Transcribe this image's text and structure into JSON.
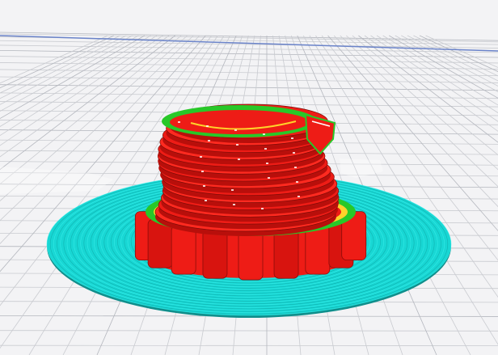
{
  "viewport": {
    "label": "",
    "view_mode": "layer-preview",
    "build_plate": "grid"
  },
  "colors": {
    "background": "#f3f3f5",
    "grid_line": "#c9cbd0",
    "grid_line_major": "#b4b7be",
    "axis_line": "#6a83c9",
    "skirt_brim": "#18d7d4",
    "skirt_brim_dark": "#0f8f8c",
    "wall_outer": "#ee1c16",
    "wall_inner": "#28c828",
    "infill": "#ffd22a",
    "support": "#9fe7ee"
  },
  "model": {
    "type": "spiral-gear-vase",
    "features": [
      "brim",
      "gear-base",
      "spiral-body",
      "top-opening"
    ]
  }
}
